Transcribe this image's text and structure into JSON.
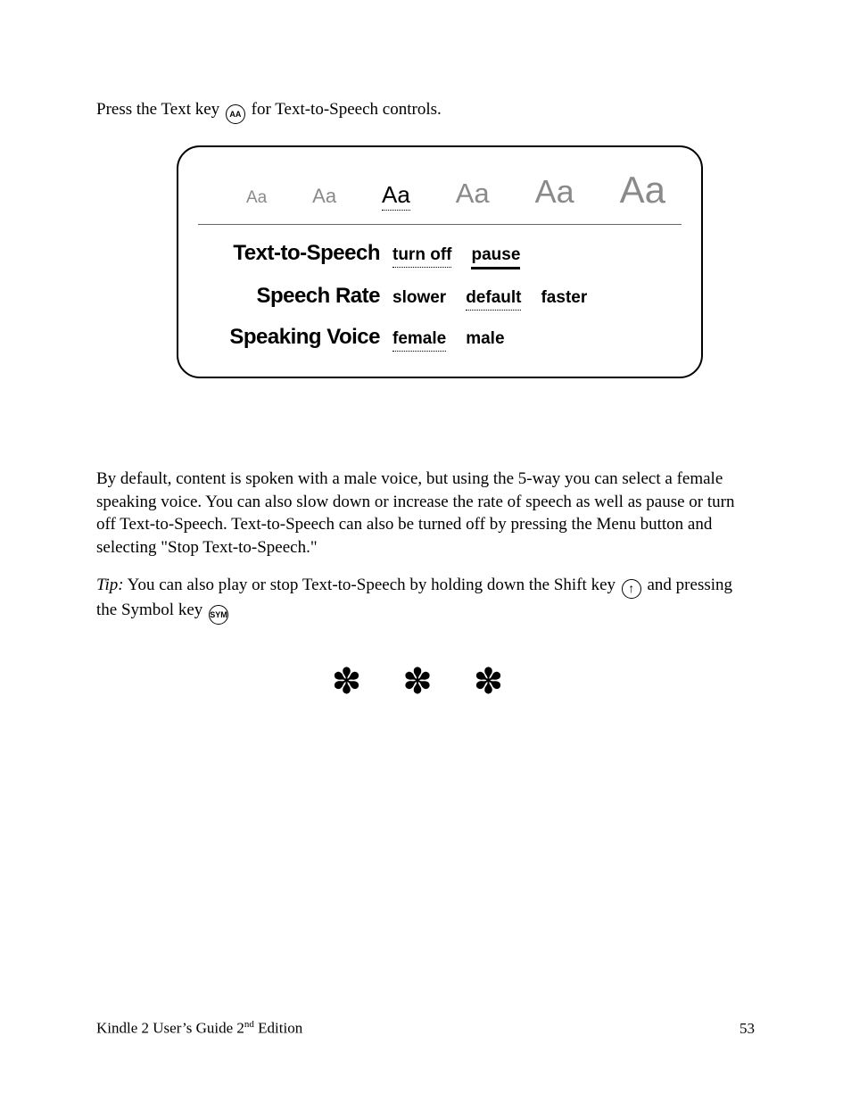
{
  "intro": {
    "pre": "Press the Text key ",
    "icon": "AA",
    "post": " for Text-to-Speech controls."
  },
  "panel": {
    "sizes": [
      "Aa",
      "Aa",
      "Aa",
      "Aa",
      "Aa",
      "Aa"
    ],
    "size_font_px": [
      19,
      22,
      26,
      31,
      36,
      42
    ],
    "size_selected_index": 2,
    "rows": [
      {
        "label": "Text-to-Speech",
        "opts": [
          {
            "text": "turn off",
            "style": "dotted"
          },
          {
            "text": "pause",
            "style": "solid"
          }
        ]
      },
      {
        "label": "Speech Rate",
        "opts": [
          {
            "text": "slower",
            "style": "none"
          },
          {
            "text": "default",
            "style": "dotted"
          },
          {
            "text": "faster",
            "style": "none"
          }
        ]
      },
      {
        "label": "Speaking Voice",
        "opts": [
          {
            "text": "female",
            "style": "dotted"
          },
          {
            "text": "male",
            "style": "none"
          }
        ]
      }
    ]
  },
  "body_para": "By default, content is spoken with a male voice, but using the 5-way you can select a female speaking voice. You can also slow down or increase the rate of speech as well as pause or turn off Text-to-Speech. Text-to-Speech can also be turned off by pressing the Menu button and selecting \"Stop Text-to-Speech.\"",
  "tip": {
    "label": "Tip:",
    "t1": " You can also play or stop Text-to-Speech by holding down the Shift key ",
    "shift_icon": "↑",
    "t2": " and pressing the Symbol key ",
    "sym_icon": "SYM"
  },
  "divider": "✽ ✽ ✽",
  "footer": {
    "title_pre": "Kindle 2 User’s Guide 2",
    "title_sup": "nd",
    "title_post": " Edition",
    "page": "53"
  }
}
